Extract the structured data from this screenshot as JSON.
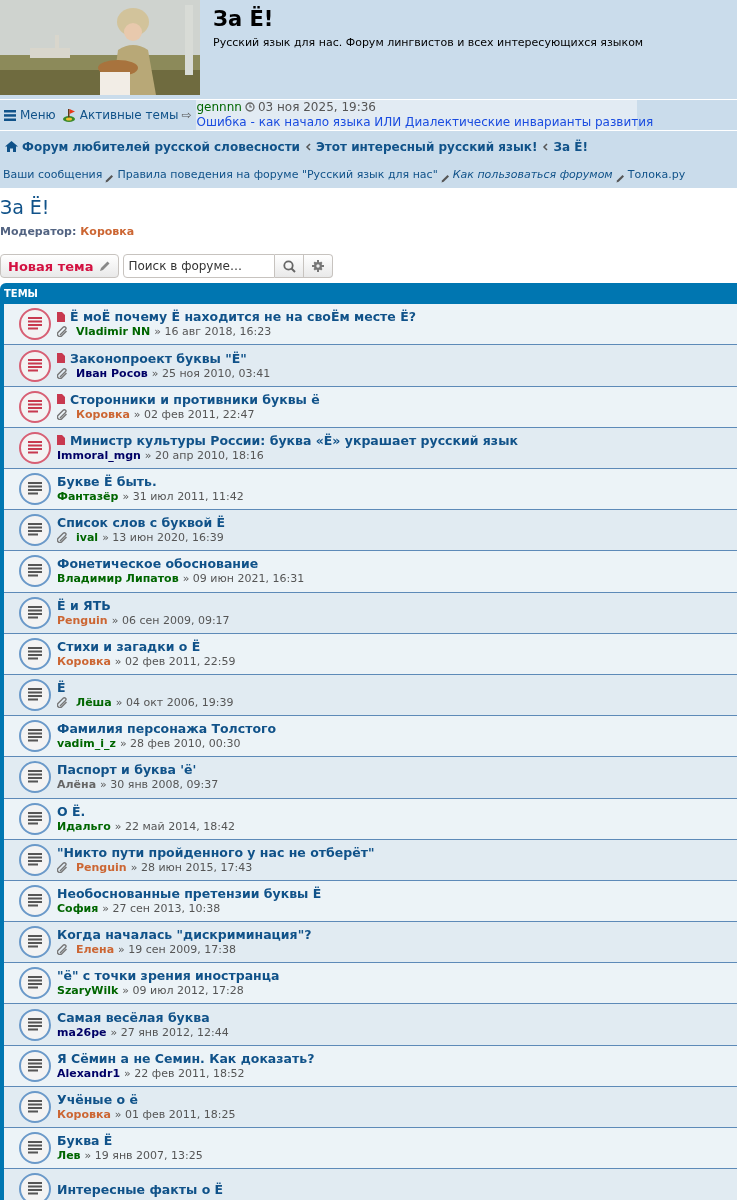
{
  "site": {
    "title": "За Ё!",
    "description": "Русский язык для нас. Форум лингвистов и всех интересующихся языком"
  },
  "navbar": {
    "menu": "Меню",
    "active_topics": "Активные темы",
    "arrow": "⇨",
    "latest": {
      "user": "gennnn",
      "time": "03 ноя 2025, 19:36",
      "topic": "Ошибка - как начало языка ИЛИ Диалектические инварианты развития"
    }
  },
  "breadcrumbs": [
    "Форум любителей русской словесности",
    "Этот интересный русский язык!",
    "За Ё!"
  ],
  "quick_links": [
    {
      "label": "Ваши сообщения",
      "italic": false
    },
    {
      "label": "Правила поведения на форуме \"Русский язык для нас\"",
      "italic": false
    },
    {
      "label": "Как пользоваться форумом",
      "italic": true
    },
    {
      "label": "Толока.ру",
      "italic": false
    }
  ],
  "forum": {
    "title": "За Ё!",
    "moderator_label": "Модератор:",
    "moderator": "Коровка"
  },
  "actions": {
    "new_topic": "Новая тема",
    "search_placeholder": "Поиск в форуме…"
  },
  "topics_header": "ТЕМЫ",
  "topics": [
    {
      "kind": "sticky",
      "title": "Ё моЁ почему Ё находится не на своЁм месте Ё?",
      "attachment": true,
      "author": "Vladimir NN",
      "color": "#006600",
      "date": "» 16 авг 2018, 16:23"
    },
    {
      "kind": "sticky",
      "title": "Законопроект буквы \"Ё\"",
      "attachment": true,
      "author": "Иван Росов",
      "color": "#000066",
      "date": "» 25 ноя 2010, 03:41"
    },
    {
      "kind": "sticky",
      "title": "Сторонники и противники буквы ё",
      "attachment": true,
      "author": "Коровка",
      "color": "#cc6633",
      "date": "» 02 фев 2011, 22:47"
    },
    {
      "kind": "sticky",
      "title": "Министр культуры России: буква «Ё» украшает русский язык",
      "attachment": false,
      "author": "Immoral_mgn",
      "color": "#000066",
      "date": "» 20 апр 2010, 18:16"
    },
    {
      "kind": "normal",
      "title": "Букве Ё быть.",
      "attachment": false,
      "author": "Фантазёр",
      "color": "#006600",
      "date": "» 31 июл 2011, 11:42"
    },
    {
      "kind": "normal",
      "title": "Список слов с буквой Ё",
      "attachment": true,
      "author": "ival",
      "color": "#006600",
      "date": "» 13 июн 2020, 16:39"
    },
    {
      "kind": "normal",
      "title": "Фонетическое обоснование",
      "attachment": false,
      "author": "Владимир Липатов",
      "color": "#006600",
      "date": "» 09 июн 2021, 16:31"
    },
    {
      "kind": "normal",
      "title": "Ё и ЯТЬ",
      "attachment": false,
      "author": "Penguin",
      "color": "#cc6633",
      "date": "» 06 сен 2009, 09:17"
    },
    {
      "kind": "normal",
      "title": "Стихи и загадки о Ё",
      "attachment": false,
      "author": "Коровка",
      "color": "#cc6633",
      "date": "» 02 фев 2011, 22:59"
    },
    {
      "kind": "normal",
      "title": "Ё",
      "attachment": true,
      "author": "Лёша",
      "color": "#006600",
      "date": "» 04 окт 2006, 19:39"
    },
    {
      "kind": "normal",
      "title": "Фамилия персонажа Толстого",
      "attachment": false,
      "author": "vadim_i_z",
      "color": "#006600",
      "date": "» 28 фев 2010, 00:30"
    },
    {
      "kind": "normal",
      "title": "Паспорт и буква 'ё'",
      "attachment": false,
      "author": "Алёна",
      "color": "#666666",
      "date": "» 30 янв 2008, 09:37"
    },
    {
      "kind": "normal",
      "title": "О Ё.",
      "attachment": false,
      "author": "Идальго",
      "color": "#006600",
      "date": "» 22 май 2014, 18:42"
    },
    {
      "kind": "normal",
      "title": "\"Никто пути пройденного у нас не отберёт\"",
      "attachment": true,
      "author": "Penguin",
      "color": "#cc6633",
      "date": "» 28 июн 2015, 17:43"
    },
    {
      "kind": "normal",
      "title": "Необоснованные претензии буквы Ё",
      "attachment": false,
      "author": "София",
      "color": "#006600",
      "date": "» 27 сен 2013, 10:38"
    },
    {
      "kind": "normal",
      "title": "Когда началась \"дискриминация\"?",
      "attachment": true,
      "author": "Елена",
      "color": "#cc6633",
      "date": "» 19 сен 2009, 17:38"
    },
    {
      "kind": "normal",
      "title": "\"ё\" с точки зрения иностранца",
      "attachment": false,
      "author": "SzaryWilk",
      "color": "#006600",
      "date": "» 09 июл 2012, 17:28"
    },
    {
      "kind": "normal",
      "title": "Самая весёлая буква",
      "attachment": false,
      "author": "ma26pe",
      "color": "#000066",
      "date": "» 27 янв 2012, 12:44"
    },
    {
      "kind": "normal",
      "title": "Я Сёмин а не Семин. Как доказать?",
      "attachment": false,
      "author": "Alexandr1",
      "color": "#000066",
      "date": "» 22 фев 2011, 18:52"
    },
    {
      "kind": "normal",
      "title": "Учёные о ё",
      "attachment": false,
      "author": "Коровка",
      "color": "#cc6633",
      "date": "» 01 фев 2011, 18:25"
    },
    {
      "kind": "normal",
      "title": "Буква Ё",
      "attachment": false,
      "author": "Лев",
      "color": "#006600",
      "date": "» 19 янв 2007, 13:25"
    },
    {
      "kind": "normal",
      "title": "Интересные факты о Ё"
    }
  ]
}
